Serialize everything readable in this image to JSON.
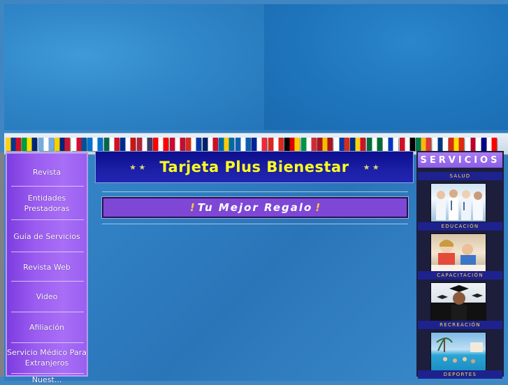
{
  "header": {
    "flags": [
      {
        "name": "colombia",
        "c": [
          "#fcd116",
          "#003893",
          "#ce1126"
        ]
      },
      {
        "name": "brazil",
        "c": [
          "#009c3b",
          "#ffdf00",
          "#002776"
        ]
      },
      {
        "name": "argentina",
        "c": [
          "#74acdf",
          "#ffffff",
          "#74acdf"
        ]
      },
      {
        "name": "venezuela",
        "c": [
          "#f4d100",
          "#00247d",
          "#cf142b"
        ]
      },
      {
        "name": "panama",
        "c": [
          "#ffffff",
          "#d21034",
          "#005293"
        ]
      },
      {
        "name": "honduras",
        "c": [
          "#0073cf",
          "#ffffff",
          "#0073cf"
        ]
      },
      {
        "name": "mexico",
        "c": [
          "#006847",
          "#ffffff",
          "#ce1126"
        ]
      },
      {
        "name": "cuba",
        "c": [
          "#002a8f",
          "#ffffff",
          "#cb1515"
        ]
      },
      {
        "name": "usa",
        "c": [
          "#b22234",
          "#ffffff",
          "#3c3b6e"
        ]
      },
      {
        "name": "canada",
        "c": [
          "#ff0000",
          "#ffffff",
          "#ff0000"
        ]
      },
      {
        "name": "denmark",
        "c": [
          "#c60c30",
          "#ffffff",
          "#c60c30"
        ]
      },
      {
        "name": "paraguay",
        "c": [
          "#d52b1e",
          "#ffffff",
          "#0038a8"
        ]
      },
      {
        "name": "uk",
        "c": [
          "#012169",
          "#ffffff",
          "#c8102e"
        ]
      },
      {
        "name": "sweden",
        "c": [
          "#006aa7",
          "#fecc00",
          "#006aa7"
        ]
      },
      {
        "name": "greece",
        "c": [
          "#0d5eaf",
          "#ffffff",
          "#0d5eaf"
        ]
      },
      {
        "name": "france",
        "c": [
          "#002395",
          "#ffffff",
          "#ed2939"
        ]
      },
      {
        "name": "switzerland",
        "c": [
          "#d52b1e",
          "#ffffff",
          "#d52b1e"
        ]
      },
      {
        "name": "germany",
        "c": [
          "#000000",
          "#dd0000",
          "#ffce00"
        ]
      },
      {
        "name": "italy",
        "c": [
          "#009246",
          "#ffffff",
          "#ce2b37"
        ]
      },
      {
        "name": "spain",
        "c": [
          "#aa151b",
          "#f1bf00",
          "#aa151b"
        ]
      },
      {
        "name": "russia",
        "c": [
          "#ffffff",
          "#0039a6",
          "#d52b1e"
        ]
      },
      {
        "name": "romania",
        "c": [
          "#002b7f",
          "#fcd116",
          "#ce1126"
        ]
      },
      {
        "name": "saudi",
        "c": [
          "#006c35",
          "#ffffff",
          "#006c35"
        ]
      },
      {
        "name": "israel",
        "c": [
          "#ffffff",
          "#0038b8",
          "#ffffff"
        ]
      },
      {
        "name": "egypt",
        "c": [
          "#ce1126",
          "#ffffff",
          "#000000"
        ]
      },
      {
        "name": "southafrica",
        "c": [
          "#007a4d",
          "#ffb612",
          "#de3831"
        ]
      },
      {
        "name": "finland",
        "c": [
          "#ffffff",
          "#003580",
          "#ffffff"
        ]
      },
      {
        "name": "china",
        "c": [
          "#de2910",
          "#ffde00",
          "#de2910"
        ]
      },
      {
        "name": "japan",
        "c": [
          "#ffffff",
          "#bc002d",
          "#ffffff"
        ]
      },
      {
        "name": "australia",
        "c": [
          "#00008b",
          "#ffffff",
          "#ff0000"
        ]
      }
    ]
  },
  "nav": {
    "items": [
      {
        "label": "Revista"
      },
      {
        "label": "Entidades Prestadoras"
      },
      {
        "label": "Guía de Servicios"
      },
      {
        "label": "Revista Web"
      },
      {
        "label": "Video"
      },
      {
        "label": "Afiliación"
      },
      {
        "label": "Servicio Médico Para Extranjeros"
      },
      {
        "label": "Nuest..."
      }
    ]
  },
  "main": {
    "title": "Tarjeta Plus Bienestar",
    "slogan": "Tu Mejor Regalo",
    "exclaim": "!",
    "star": "★ ★"
  },
  "services": {
    "title": "SERVICIOS",
    "categories": [
      {
        "label": "SALUD"
      },
      {
        "label": "EDUCACIÓN"
      },
      {
        "label": "CAPACITACIÓN"
      },
      {
        "label": "RECREACIÓN"
      },
      {
        "label": "DEPORTES"
      }
    ]
  },
  "colors": {
    "accent_purple": "#9b5cf0",
    "title_blue": "#1c1fa6",
    "title_yellow": "#ffff1f",
    "slogan_bg": "#7e47d6",
    "label_gold": "#ffd94a"
  }
}
